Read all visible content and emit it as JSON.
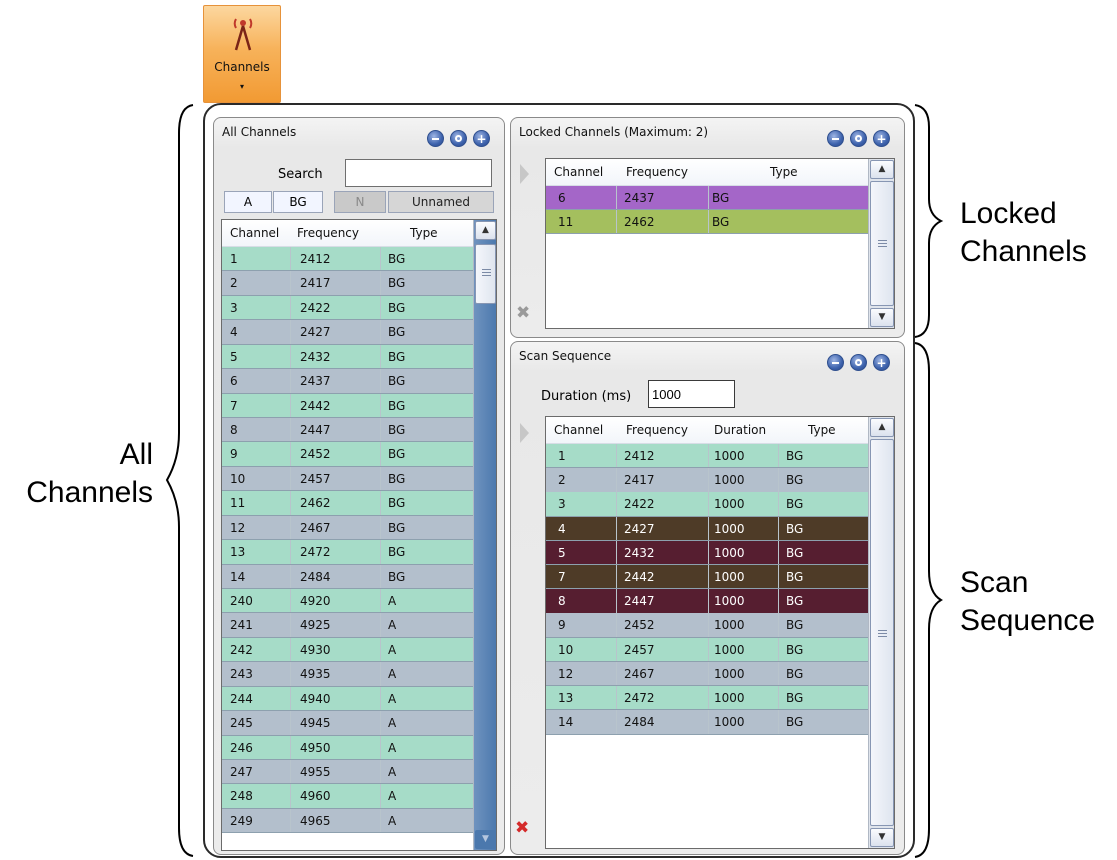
{
  "ribbon": {
    "channels_label": "Channels",
    "dropdown_glyph": "▾",
    "icon": "antenna-icon"
  },
  "all_channels": {
    "title": "All Channels",
    "search_label": "Search",
    "search_value": "",
    "filters": [
      "A",
      "BG",
      "N",
      "Unnamed"
    ],
    "columns": [
      "Channel",
      "Frequency",
      "Type"
    ],
    "rows": [
      [
        "1",
        "2412",
        "BG"
      ],
      [
        "2",
        "2417",
        "BG"
      ],
      [
        "3",
        "2422",
        "BG"
      ],
      [
        "4",
        "2427",
        "BG"
      ],
      [
        "5",
        "2432",
        "BG"
      ],
      [
        "6",
        "2437",
        "BG"
      ],
      [
        "7",
        "2442",
        "BG"
      ],
      [
        "8",
        "2447",
        "BG"
      ],
      [
        "9",
        "2452",
        "BG"
      ],
      [
        "10",
        "2457",
        "BG"
      ],
      [
        "11",
        "2462",
        "BG"
      ],
      [
        "12",
        "2467",
        "BG"
      ],
      [
        "13",
        "2472",
        "BG"
      ],
      [
        "14",
        "2484",
        "BG"
      ],
      [
        "240",
        "4920",
        "A"
      ],
      [
        "241",
        "4925",
        "A"
      ],
      [
        "242",
        "4930",
        "A"
      ],
      [
        "243",
        "4935",
        "A"
      ],
      [
        "244",
        "4940",
        "A"
      ],
      [
        "245",
        "4945",
        "A"
      ],
      [
        "246",
        "4950",
        "A"
      ],
      [
        "247",
        "4955",
        "A"
      ],
      [
        "248",
        "4960",
        "A"
      ],
      [
        "249",
        "4965",
        "A"
      ]
    ]
  },
  "locked_channels": {
    "title": "Locked Channels (Maximum: 2)",
    "columns": [
      "Channel",
      "Frequency",
      "Type"
    ],
    "rows": [
      {
        "cells": [
          "6",
          "2437",
          "BG"
        ],
        "color": "#a466c8"
      },
      {
        "cells": [
          "11",
          "2462",
          "BG"
        ],
        "color": "#a4bf5e"
      }
    ]
  },
  "scan_sequence": {
    "title": "Scan Sequence",
    "duration_label": "Duration (ms)",
    "duration_value": "1000",
    "columns": [
      "Channel",
      "Frequency",
      "Duration",
      "Type"
    ],
    "rows": [
      {
        "cells": [
          "1",
          "2412",
          "1000",
          "BG"
        ],
        "color": "#a6dcc8"
      },
      {
        "cells": [
          "2",
          "2417",
          "1000",
          "BG"
        ],
        "color": "#b3bfcc"
      },
      {
        "cells": [
          "3",
          "2422",
          "1000",
          "BG"
        ],
        "color": "#a6dcc8"
      },
      {
        "cells": [
          "4",
          "2427",
          "1000",
          "BG"
        ],
        "color": "#4e3b27",
        "dark": true
      },
      {
        "cells": [
          "5",
          "2432",
          "1000",
          "BG"
        ],
        "color": "#561e30",
        "dark": true
      },
      {
        "cells": [
          "7",
          "2442",
          "1000",
          "BG"
        ],
        "color": "#4e3b27",
        "dark": true
      },
      {
        "cells": [
          "8",
          "2447",
          "1000",
          "BG"
        ],
        "color": "#561e30",
        "dark": true
      },
      {
        "cells": [
          "9",
          "2452",
          "1000",
          "BG"
        ],
        "color": "#b3bfcc"
      },
      {
        "cells": [
          "10",
          "2457",
          "1000",
          "BG"
        ],
        "color": "#a6dcc8"
      },
      {
        "cells": [
          "12",
          "2467",
          "1000",
          "BG"
        ],
        "color": "#b3bfcc"
      },
      {
        "cells": [
          "13",
          "2472",
          "1000",
          "BG"
        ],
        "color": "#a6dcc8"
      },
      {
        "cells": [
          "14",
          "2484",
          "1000",
          "BG"
        ],
        "color": "#b3bfcc"
      }
    ]
  },
  "annotations": {
    "all_line1": "All",
    "all_line2": "Channels",
    "locked_line1": "Locked",
    "locked_line2": "Channels",
    "scan_line1": "Scan",
    "scan_line2": "Sequence"
  },
  "colors": {
    "row_green": "#a6dcc8",
    "row_gray": "#b3bfcc",
    "accent_orange": "#f29a33"
  }
}
